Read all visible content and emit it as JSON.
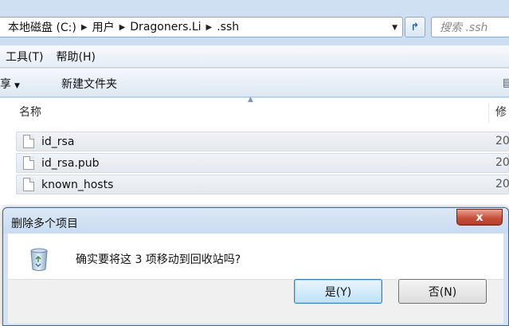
{
  "explorer": {
    "breadcrumb": [
      "本地磁盘 (C:)",
      "用户",
      "Dragoners.Li",
      ".ssh"
    ],
    "search_placeholder": "搜索 .ssh",
    "menu": [
      "工具(T)",
      "帮助(H)"
    ],
    "toolbar": {
      "share_label": "共享",
      "new_folder_label": "新建文件夹"
    },
    "columns": {
      "name": "名称",
      "modified": "修"
    },
    "files": [
      {
        "name": "id_rsa",
        "date": "20"
      },
      {
        "name": "id_rsa.pub",
        "date": "20"
      },
      {
        "name": "known_hosts",
        "date": "20"
      }
    ]
  },
  "dialog": {
    "title": "删除多个项目",
    "close_label": "x",
    "message": "确实要将这 3 项移动到回收站吗?",
    "yes_label": "是(Y)",
    "no_label": "否(N)"
  },
  "icons": {
    "address_dropdown": "chevron-down-icon",
    "refresh": "refresh-icon",
    "view_mode": "view-mode-icon",
    "file": "file-icon",
    "recycle": "recycle-bin-icon"
  },
  "colors": {
    "titlebar": "#c8dbf0",
    "close_button": "#c7503c",
    "default_button_border": "#3c7fb1"
  }
}
